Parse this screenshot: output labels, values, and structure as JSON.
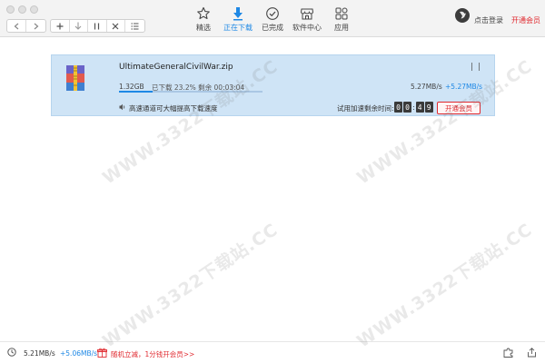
{
  "toolbar": {
    "tabs": [
      {
        "label": "精选",
        "icon": "star-icon"
      },
      {
        "label": "正在下载",
        "icon": "download-arrow-icon",
        "active": true
      },
      {
        "label": "已完成",
        "icon": "check-circle-icon"
      },
      {
        "label": "软件中心",
        "icon": "store-icon"
      },
      {
        "label": "应用",
        "icon": "apps-grid-icon"
      }
    ],
    "nav_buttons": [
      "back-icon",
      "forward-icon"
    ],
    "action_buttons": [
      "add-icon",
      "download-icon",
      "pause-icon",
      "delete-icon",
      "list-icon"
    ],
    "login": "点击登录",
    "vip": "开通会员"
  },
  "download": {
    "filename": "UltimateGeneralCivilWar.zip",
    "size": "1.32GB",
    "downloaded_label": "已下载",
    "percent": "23.2%",
    "percent_value": 0.232,
    "remaining_label": "剩余",
    "remaining": "00:03:04",
    "speed": "5.27MB/s",
    "boost": "+5.27MB/s",
    "tip": "高速通道可大幅提高下载速度",
    "trial_label": "试用加速剩余时间:",
    "timer": [
      "0",
      "0",
      "4",
      "9"
    ],
    "vip_button": "开通会员",
    "pause": "| |"
  },
  "bottom": {
    "down_speed": "5.21MB/s",
    "up_speed": "+5.06MB/s",
    "promo": "随机立减，1分钱开会员>>"
  },
  "watermark": "WWW.3322下载站.CC",
  "colors": {
    "accent": "#1e88e5",
    "vip_red": "#e0292f",
    "item_bg": "#cfe4f6"
  }
}
